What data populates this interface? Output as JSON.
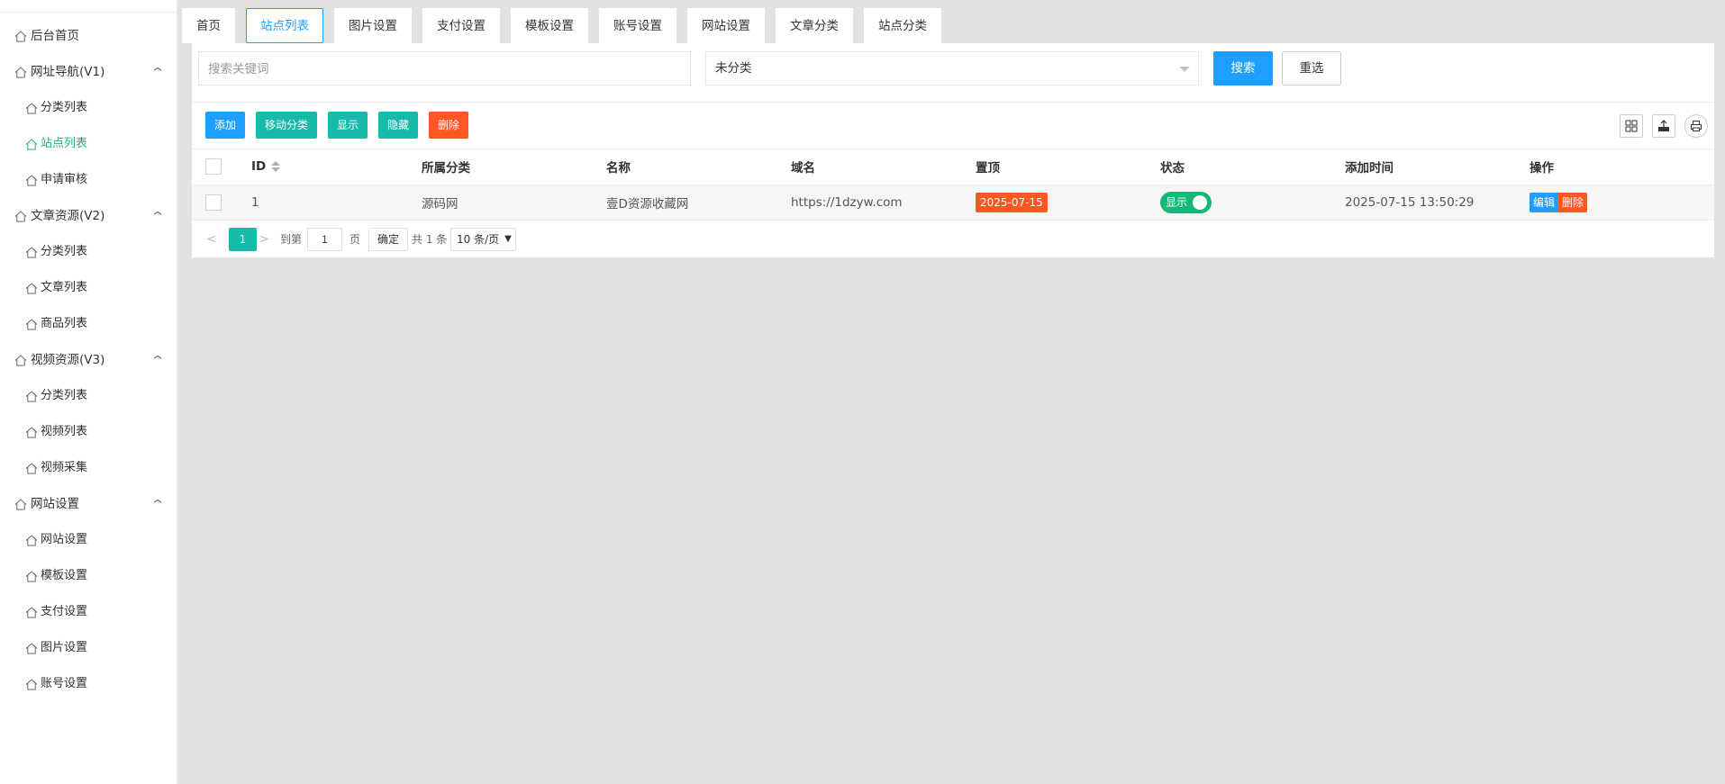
{
  "sidebar": {
    "groups": [
      {
        "title": "后台首页",
        "collapsible": false,
        "items": []
      },
      {
        "title": "网址导航(V1)",
        "collapsible": true,
        "items": [
          {
            "label": "分类列表",
            "active": false
          },
          {
            "label": "站点列表",
            "active": true
          },
          {
            "label": "申请审核",
            "active": false
          }
        ]
      },
      {
        "title": "文章资源(V2)",
        "collapsible": true,
        "items": [
          {
            "label": "分类列表",
            "active": false
          },
          {
            "label": "文章列表",
            "active": false
          },
          {
            "label": "商品列表",
            "active": false
          }
        ]
      },
      {
        "title": "视频资源(V3)",
        "collapsible": true,
        "items": [
          {
            "label": "分类列表",
            "active": false
          },
          {
            "label": "视频列表",
            "active": false
          },
          {
            "label": "视频采集",
            "active": false
          }
        ]
      },
      {
        "title": "网站设置",
        "collapsible": true,
        "items": [
          {
            "label": "网站设置",
            "active": false
          },
          {
            "label": "模板设置",
            "active": false
          },
          {
            "label": "支付设置",
            "active": false
          },
          {
            "label": "图片设置",
            "active": false
          },
          {
            "label": "账号设置",
            "active": false
          }
        ]
      }
    ],
    "chevron": "^"
  },
  "tabs": [
    {
      "label": "首页",
      "active": false
    },
    {
      "label": "站点列表",
      "active": true
    },
    {
      "label": "图片设置",
      "active": false
    },
    {
      "label": "支付设置",
      "active": false
    },
    {
      "label": "模板设置",
      "active": false
    },
    {
      "label": "账号设置",
      "active": false
    },
    {
      "label": "网站设置",
      "active": false
    },
    {
      "label": "文章分类",
      "active": false
    },
    {
      "label": "站点分类",
      "active": false
    }
  ],
  "search": {
    "placeholder": "搜索关键词",
    "value": "",
    "category_selected": "未分类",
    "search_label": "搜索",
    "reset_label": "重选"
  },
  "toolbar": {
    "add": "添加",
    "move": "移动分类",
    "show": "显示",
    "hide": "隐藏",
    "delete": "删除",
    "icons": [
      "columns-icon",
      "export-icon",
      "print-icon"
    ]
  },
  "table": {
    "headers": {
      "id": "ID",
      "category": "所属分类",
      "name": "名称",
      "domain": "域名",
      "pin": "置顶",
      "status": "状态",
      "added": "添加时间",
      "ops": "操作"
    },
    "rows": [
      {
        "id": "1",
        "category": "源码网",
        "name": "壹D资源收藏网",
        "domain": "https://1dzyw.com",
        "pin": "2025-07-15",
        "status": "显示",
        "added": "2025-07-15 13:50:29",
        "edit": "编辑",
        "delete": "删除"
      }
    ]
  },
  "pager": {
    "prev": "<",
    "current": "1",
    "next": ">",
    "goto_label": "到第",
    "goto_value": "1",
    "page_label": "页",
    "confirm": "确定",
    "total": "共 1 条",
    "per_page": "10 条/页"
  },
  "colors": {
    "blue": "#1e9fff",
    "teal": "#16baaa",
    "orange": "#ff5722",
    "green": "#16b777"
  }
}
